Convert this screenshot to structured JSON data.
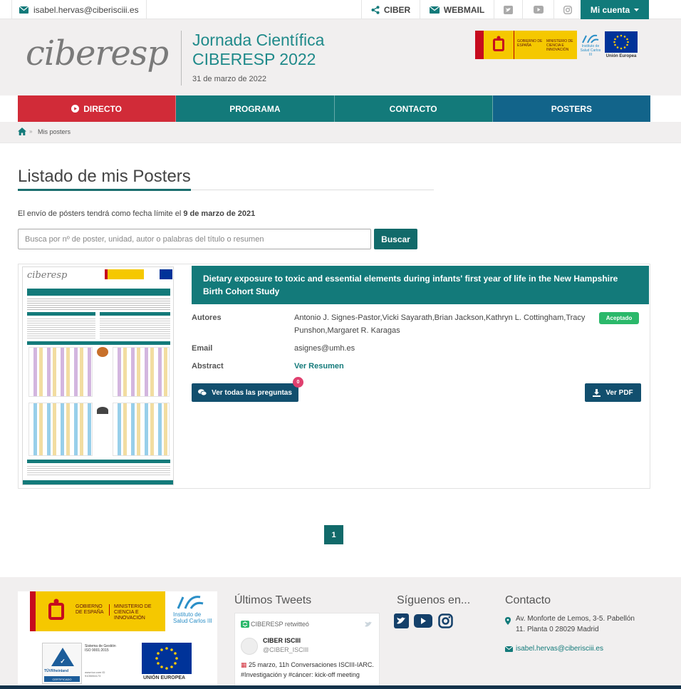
{
  "topbar": {
    "email": "isabel.hervas@ciberisciii.es",
    "ciber_label": "CIBER",
    "webmail_label": "WEBMAIL",
    "account_label": "Mi cuenta"
  },
  "header": {
    "logo_text": "ciberesp",
    "title_line1": "Jornada Científica",
    "title_line2": "CIBERESP 2022",
    "date": "31 de marzo de 2022",
    "sponsor_gobierno": "GOBIERNO DE ESPAÑA",
    "sponsor_ministerio": "MINISTERIO DE CIENCIA E INNOVACIÓN",
    "sponsor_isciii": "Instituto de Salud Carlos III",
    "sponsor_eu": "Unión Europea"
  },
  "nav": {
    "items": [
      {
        "label": "DIRECTO",
        "color": "#d12b38"
      },
      {
        "label": "PROGRAMA",
        "color": "#137a7a"
      },
      {
        "label": "CONTACTO",
        "color": "#137a7a"
      },
      {
        "label": "POSTERS",
        "color": "#12648a"
      }
    ]
  },
  "breadcrumb": {
    "current": "Mis posters"
  },
  "main": {
    "title": "Listado de mis Posters",
    "notice_prefix": "El envío de pósters tendrá como fecha límite el ",
    "notice_date": "9 de marzo de 2021",
    "search_placeholder": "Busca por nº de poster, unidad, autor o palabras del título o resumen",
    "search_button": "Buscar"
  },
  "poster": {
    "title": "Dietary exposure to toxic and essential elements during infants' first year of life in the New Hampshire Birth Cohort Study",
    "authors_label": "Autores",
    "authors": "Antonio J. Signes-Pastor,Vicki Sayarath,Brian Jackson,Kathryn L. Cottingham,Tracy Punshon,Margaret R. Karagas",
    "status": "Aceptado",
    "email_label": "Email",
    "email": "asignes@umh.es",
    "abstract_label": "Abstract",
    "abstract_link": "Ver Resumen",
    "questions_button": "Ver todas las preguntas",
    "questions_count": "0",
    "pdf_button": "Ver PDF",
    "thumb_logo": "ciberesp"
  },
  "pagination": {
    "current_page": "1"
  },
  "footer": {
    "tweets_heading": "Últimos Tweets",
    "follow_heading": "Síguenos en...",
    "contact_heading": "Contacto",
    "retweet_label": "CIBERESP retwitteó",
    "tweet_author": "CIBER ISCIII",
    "tweet_handle": "@CIBER_ISCIII",
    "tweet_text": "25 marzo, 11h Conversaciones ISCIII-IARC. #Investigación y #cáncer: kick-off meeting",
    "address": "Av. Monforte de Lemos, 3-5. Pabellón 11. Planta 0 28029 Madrid",
    "contact_email": "isabel.hervas@ciberisciii.es",
    "cert_text": "Sistema de Gestión ISO 9001:2015",
    "cert_brand": "TÜVRheinland",
    "cert_badge": "CERTIFICADO",
    "cert_id": "www.tuv.com ID 9105054173",
    "eu_label": "UNIÓN EUROPEA"
  },
  "colors": {
    "teal": "#137a7a",
    "red": "#d12b38",
    "blue": "#12648a",
    "green_badge": "#2bb86a",
    "pink_badge": "#e0406f"
  }
}
